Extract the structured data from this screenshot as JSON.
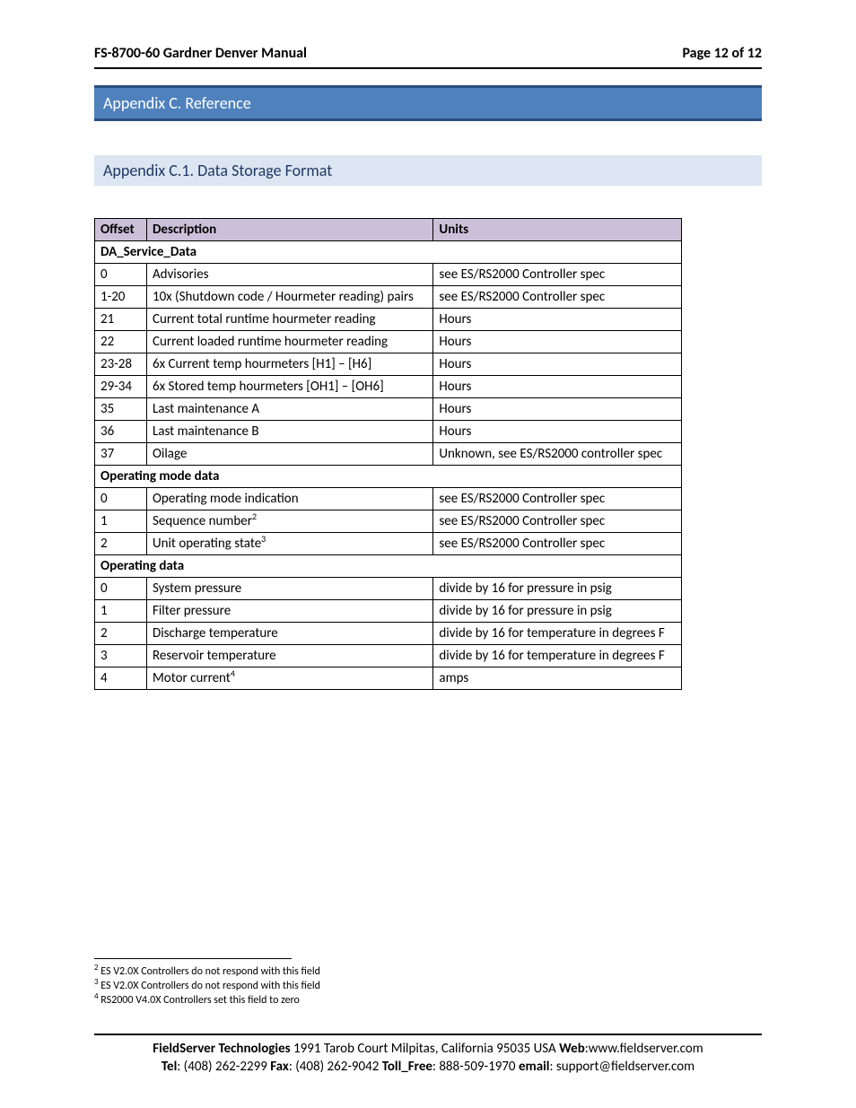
{
  "header": {
    "title": "FS-8700-60 Gardner Denver Manual",
    "page_info": "Page 12 of 12"
  },
  "section_c": {
    "title": "Appendix C. Reference"
  },
  "section_c1": {
    "title": "Appendix C.1. Data Storage Format"
  },
  "table": {
    "head": {
      "offset": "Offset",
      "description": "Description",
      "units": "Units"
    },
    "groups": [
      {
        "title": "DA_Service_Data",
        "rows": [
          {
            "offset": "0",
            "desc": "Advisories",
            "units": "see ES/RS2000 Controller spec"
          },
          {
            "offset": "1-20",
            "desc": "10x (Shutdown code / Hourmeter reading) pairs",
            "units": "see ES/RS2000 Controller spec"
          },
          {
            "offset": "21",
            "desc": "Current total runtime hourmeter reading",
            "units": "Hours"
          },
          {
            "offset": "22",
            "desc": "Current loaded runtime hourmeter reading",
            "units": "Hours"
          },
          {
            "offset": "23-28",
            "desc": "6x Current temp hourmeters [H1] – [H6]",
            "units": "Hours"
          },
          {
            "offset": "29-34",
            "desc": "6x Stored temp hourmeters [OH1] – [OH6]",
            "units": "Hours"
          },
          {
            "offset": "35",
            "desc": "Last maintenance A",
            "units": "Hours"
          },
          {
            "offset": "36",
            "desc": "Last maintenance B",
            "units": "Hours"
          },
          {
            "offset": "37",
            "desc": "Oilage",
            "units": "Unknown, see ES/RS2000 controller spec"
          }
        ]
      },
      {
        "title": "Operating mode data",
        "rows": [
          {
            "offset": "0",
            "desc": "Operating mode indication",
            "units": "see ES/RS2000 Controller spec"
          },
          {
            "offset": "1",
            "desc": "Sequence number",
            "sup": "2",
            "units": "see ES/RS2000 Controller spec"
          },
          {
            "offset": "2",
            "desc": "Unit operating state",
            "sup": "3",
            "units": "see ES/RS2000 Controller spec"
          }
        ]
      },
      {
        "title": "Operating data",
        "rows": [
          {
            "offset": "0",
            "desc": "System pressure",
            "units": "divide by 16 for pressure in psig"
          },
          {
            "offset": "1",
            "desc": "Filter pressure",
            "units": "divide by 16 for pressure in psig"
          },
          {
            "offset": "2",
            "desc": "Discharge temperature",
            "units": "divide by 16 for temperature in degrees F"
          },
          {
            "offset": "3",
            "desc": "Reservoir temperature",
            "units": "divide by 16 for temperature in degrees F"
          },
          {
            "offset": "4",
            "desc": "Motor current",
            "sup": "4",
            "units": "amps"
          }
        ]
      }
    ]
  },
  "footnotes": [
    {
      "num": "2",
      "text": "ES V2.0X Controllers do not respond with this field"
    },
    {
      "num": "3",
      "text": "ES V2.0X Controllers do not respond with this field"
    },
    {
      "num": "4",
      "text": "RS2000 V4.0X Controllers set this field to zero"
    }
  ],
  "footer": {
    "labels": {
      "company": "FieldServer Technologies",
      "web": "Web",
      "tel": "Tel",
      "fax": "Fax",
      "tollfree": "Toll_Free",
      "email": "email"
    },
    "address": " 1991 Tarob Court Milpitas, California 95035 USA  ",
    "web": ":www.fieldserver.com",
    "tel": ": (408) 262-2299  ",
    "fax": ": (408) 262-9042  ",
    "tollfree": ": 888-509-1970  ",
    "email": ": support@fieldserver.com"
  }
}
